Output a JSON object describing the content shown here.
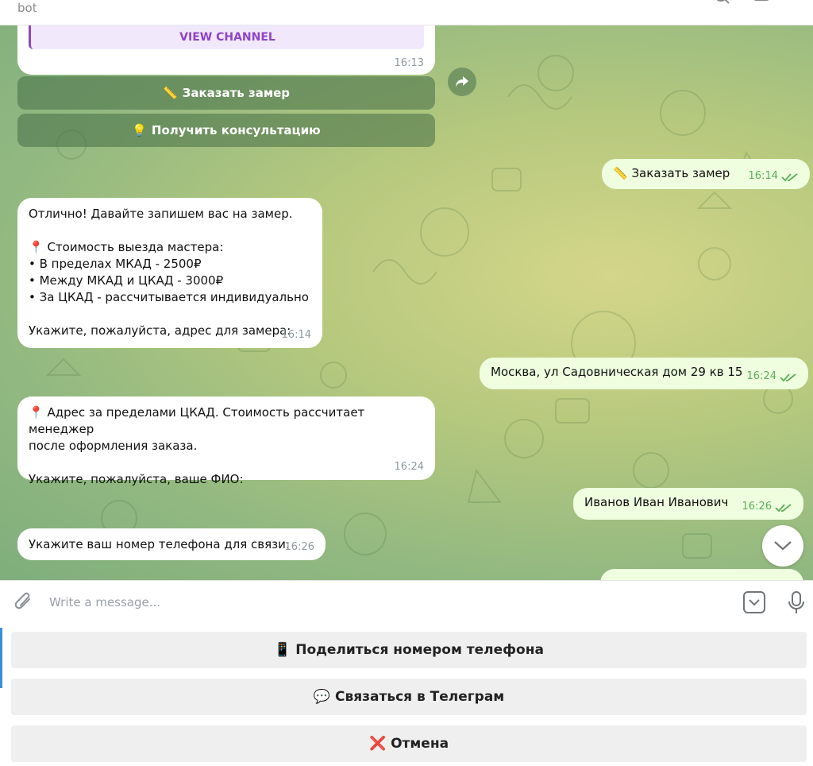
{
  "header": {
    "status": "bot"
  },
  "chat": {
    "channel_label": "VIEW CHANNEL",
    "channel_time": "16:13",
    "inline_buttons": [
      {
        "emoji": "📏",
        "label": "Заказать замер"
      },
      {
        "emoji": "💡",
        "label": "Получить консультацию"
      }
    ],
    "messages": [
      {
        "direction": "out",
        "text": "📏 Заказать замер",
        "time": "16:14"
      },
      {
        "direction": "in",
        "text": "Отлично! Давайте запишем вас на замер.\n\n📍 Стоимость выезда мастера:\n• В пределах МКАД - 2500₽\n• Между МКАД и ЦКАД - 3000₽\n• За ЦКАД - рассчитывается индивидуально\n\nУкажите, пожалуйста, адрес для замера:",
        "time": "16:14"
      },
      {
        "direction": "out",
        "text": "Москва, ул Садовническая дом 29 кв 15",
        "time": "16:24"
      },
      {
        "direction": "in",
        "text": "📍 Адрес за пределами ЦКАД. Стоимость рассчитает менеджер\nпосле оформления заказа.\n\nУкажите, пожалуйста, ваше ФИО:",
        "time": "16:24"
      },
      {
        "direction": "out",
        "text": "Иванов Иван Иванович",
        "time": "16:26"
      },
      {
        "direction": "in",
        "text": "Укажите ваш номер телефона для связи:",
        "time": "16:26"
      }
    ]
  },
  "composer": {
    "placeholder": "Write a message..."
  },
  "reply_keyboard": [
    {
      "emoji": "📱",
      "label": "Поделиться номером телефона"
    },
    {
      "emoji": "💬",
      "label": "Связаться в Телеграм"
    },
    {
      "emoji": "❌",
      "label": "Отмена"
    }
  ],
  "icons": {
    "share": "share-arrow-icon",
    "scroll": "chevron-down-icon",
    "attach": "paperclip-icon",
    "commands": "keyboard-toggle-icon",
    "mic": "microphone-icon",
    "read": "double-check-icon"
  },
  "colors": {
    "outgoing_bubble": "#eefedf",
    "incoming_bubble": "#ffffff",
    "accent": "#3a8fd9",
    "channel_text": "#8e44c8",
    "channel_bg": "#f1e9fb"
  }
}
